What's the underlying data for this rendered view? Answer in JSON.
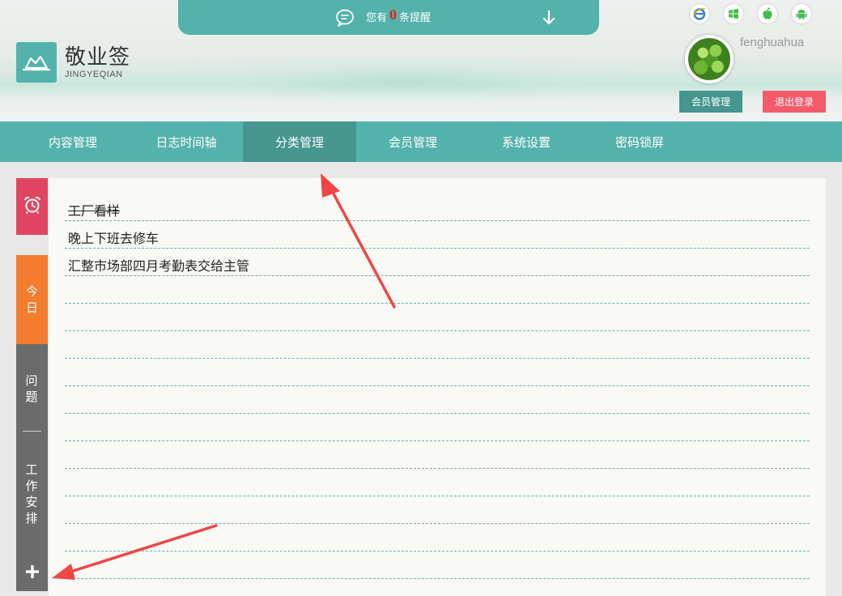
{
  "header": {
    "logo_title": "敬业签",
    "logo_subtitle": "JINGYEQIAN",
    "notice": {
      "prefix": "您有",
      "count": "0",
      "suffix": "条提醒"
    },
    "platform_icons": [
      "ie-icon",
      "windows-icon",
      "apple-icon",
      "android-icon"
    ],
    "username": "fenghuahua",
    "member_button": "会员管理",
    "logout_button": "退出登录"
  },
  "nav": {
    "items": [
      "内容管理",
      "日志时间轴",
      "分类管理",
      "会员管理",
      "系统设置",
      "密码锁屏"
    ],
    "active_index": 2
  },
  "sidebar": {
    "today": "今日",
    "issue": "问题",
    "work": "工作安排"
  },
  "tasks": [
    {
      "text": "工厂看样",
      "done": true
    },
    {
      "text": "晚上下班去修车",
      "done": false
    },
    {
      "text": "汇整市场部四月考勤表交给主管",
      "done": false
    }
  ],
  "colors": {
    "accent": "#54b2ac",
    "accent_dark": "#44968f",
    "alarm": "#e04561",
    "today": "#f37c2e",
    "logout": "#f35b6b",
    "annotation_arrow": "#ef4646"
  }
}
